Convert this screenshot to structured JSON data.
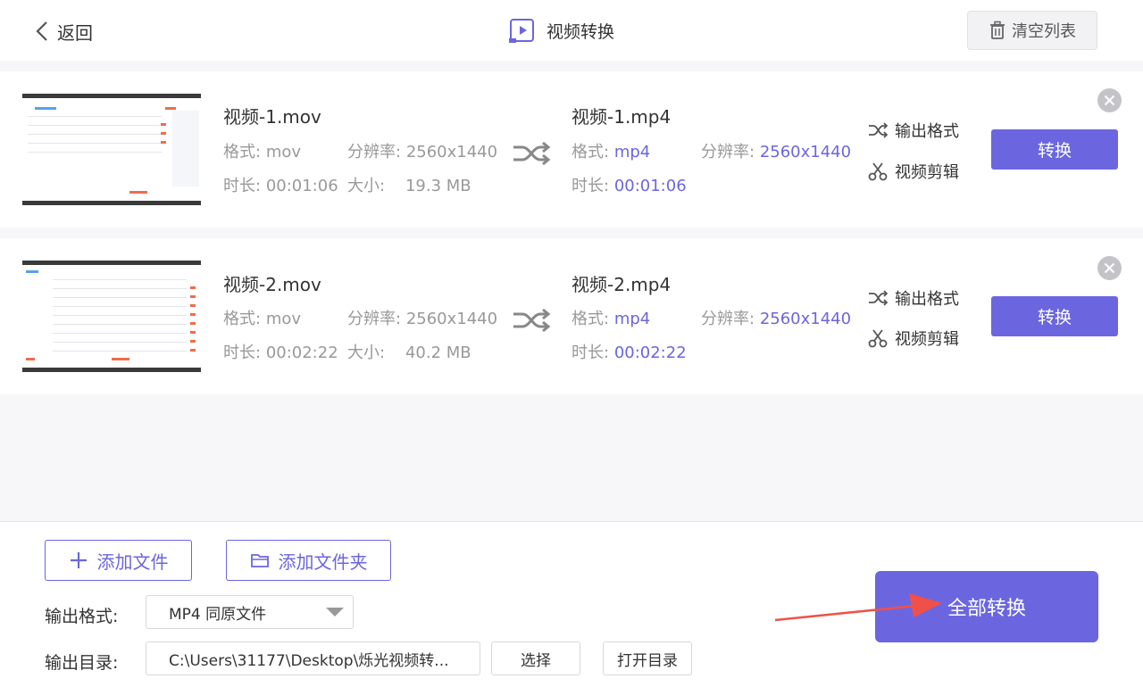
{
  "header": {
    "back_label": "返回",
    "title": "视频转换",
    "clear_label": "清空列表"
  },
  "files": [
    {
      "source_name": "视频-1.mov",
      "format_label": "格式:",
      "source_format": "mov",
      "resolution_label": "分辨率:",
      "source_resolution": "2560x1440",
      "duration_label": "时长:",
      "source_duration": "00:01:06",
      "size_label": "大小:",
      "source_size": "19.3 MB",
      "target_name": "视频-1.mp4",
      "target_format": "mp4",
      "target_resolution": "2560x1440",
      "target_duration": "00:01:06",
      "output_format_label": "输出格式",
      "video_edit_label": "视频剪辑",
      "convert_label": "转换"
    },
    {
      "source_name": "视频-2.mov",
      "format_label": "格式:",
      "source_format": "mov",
      "resolution_label": "分辨率:",
      "source_resolution": "2560x1440",
      "duration_label": "时长:",
      "source_duration": "00:02:22",
      "size_label": "大小:",
      "source_size": "40.2 MB",
      "target_name": "视频-2.mp4",
      "target_format": "mp4",
      "target_resolution": "2560x1440",
      "target_duration": "00:02:22",
      "output_format_label": "输出格式",
      "video_edit_label": "视频剪辑",
      "convert_label": "转换"
    }
  ],
  "footer": {
    "add_file_label": "添加文件",
    "add_folder_label": "添加文件夹",
    "output_format_label": "输出格式:",
    "output_format_value": "MP4 同原文件",
    "output_dir_label": "输出目录:",
    "output_dir_value": "C:\\Users\\31177\\Desktop\\烁光视频转...",
    "choose_label": "选择",
    "open_dir_label": "打开目录",
    "convert_all_label": "全部转换"
  },
  "colors": {
    "accent": "#6b66e0",
    "annotation_arrow": "#f0504a"
  }
}
